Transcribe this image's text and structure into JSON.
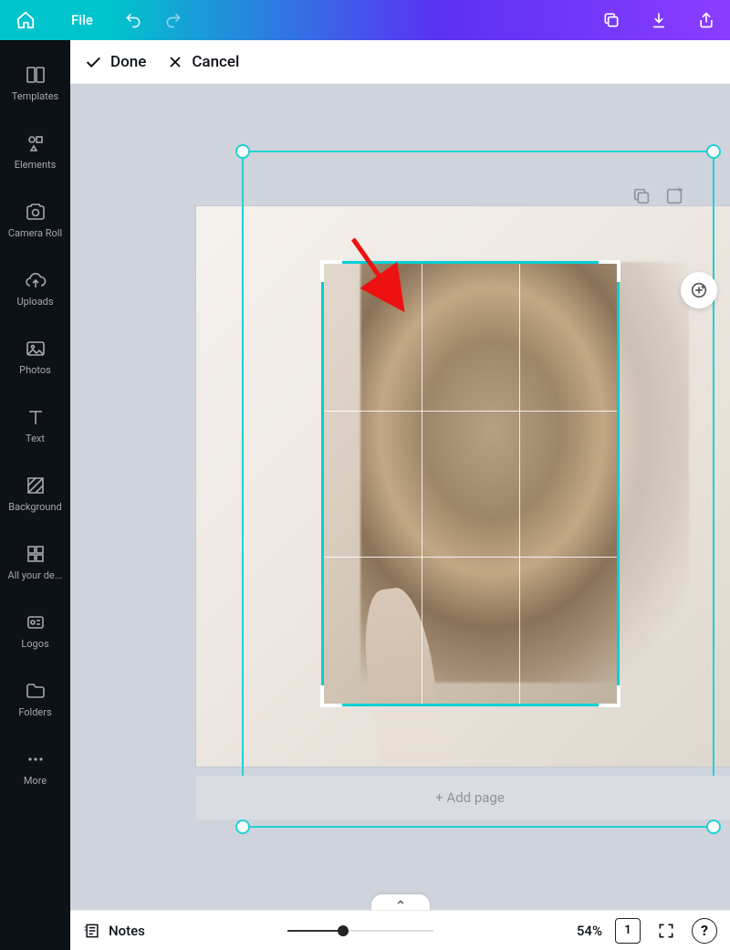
{
  "topbar": {
    "file_label": "File"
  },
  "sidebar": {
    "items": [
      {
        "label": "Templates"
      },
      {
        "label": "Elements"
      },
      {
        "label": "Camera Roll"
      },
      {
        "label": "Uploads"
      },
      {
        "label": "Photos"
      },
      {
        "label": "Text"
      },
      {
        "label": "Background"
      },
      {
        "label": "All your de..."
      },
      {
        "label": "Logos"
      },
      {
        "label": "Folders"
      },
      {
        "label": "More"
      }
    ]
  },
  "contextbar": {
    "done_label": "Done",
    "cancel_label": "Cancel"
  },
  "canvas": {
    "add_page_label": "+ Add page"
  },
  "bottombar": {
    "notes_label": "Notes",
    "zoom_value": "54%",
    "page_number": "1",
    "help_label": "?"
  },
  "colors": {
    "accent": "#00c4cc",
    "selection": "#1fd1d3",
    "crop": "#00d1d4"
  }
}
